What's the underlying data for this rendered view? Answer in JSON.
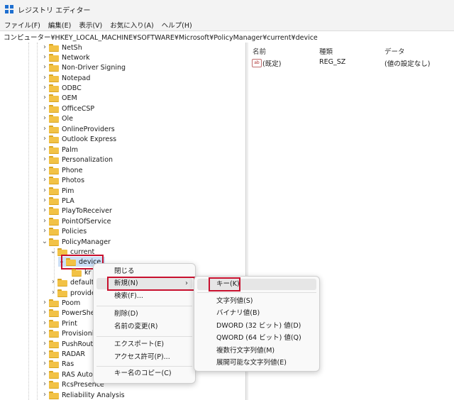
{
  "window": {
    "title": "レジストリ エディター"
  },
  "menu": [
    "ファイル(F)",
    "編集(E)",
    "表示(V)",
    "お気に入り(A)",
    "ヘルプ(H)"
  ],
  "address": {
    "value": "コンピューター¥HKEY_LOCAL_MACHINE¥SOFTWARE¥Microsoft¥PolicyManager¥current¥device"
  },
  "tree": {
    "items": [
      "NetSh",
      "Network",
      "Non-Driver Signing",
      "Notepad",
      "ODBC",
      "OEM",
      "OfficeCSP",
      "Ole",
      "OnlineProviders",
      "Outlook Express",
      "Palm",
      "Personalization",
      "Phone",
      "Photos",
      "Pim",
      "PLA",
      "PlayToReceiver",
      "PointOfService",
      "Policies",
      "PolicyManager"
    ],
    "current": "current",
    "device": "device",
    "device_child": "kr",
    "default": "default",
    "providers": "provide",
    "after": [
      "Poom",
      "PowerShell",
      "Print",
      "Provisioning",
      "PushRoute",
      "RADAR",
      "Ras",
      "RAS AutoD",
      "RcsPresence",
      "Reliability Analysis"
    ]
  },
  "values": {
    "columns": {
      "name": "名前",
      "type": "種類",
      "data": "データ"
    },
    "rows": [
      {
        "icon": "string-value-icon",
        "icon_text": "ab",
        "name": "(既定)",
        "type": "REG_SZ",
        "data": "(値の設定なし)"
      }
    ]
  },
  "context_menu": {
    "close": "閉じる",
    "new": "新規(N)",
    "find": "検索(F)...",
    "delete": "削除(D)",
    "rename": "名前の変更(R)",
    "export": "エクスポート(E)",
    "permissions": "アクセス許可(P)...",
    "copy_key_name": "キー名のコピー(C)"
  },
  "new_submenu": {
    "key": "キー(K)",
    "string": "文字列値(S)",
    "binary": "バイナリ値(B)",
    "dword": "DWORD (32 ビット) 値(D)",
    "qword": "QWORD (64 ビット) 値(Q)",
    "multi_string": "複数行文字列値(M)",
    "expandable_string": "展開可能な文字列値(E)"
  },
  "colors": {
    "highlight_border": "#c8102e",
    "folder": "#f2c246",
    "selection": "#cce0f7"
  }
}
